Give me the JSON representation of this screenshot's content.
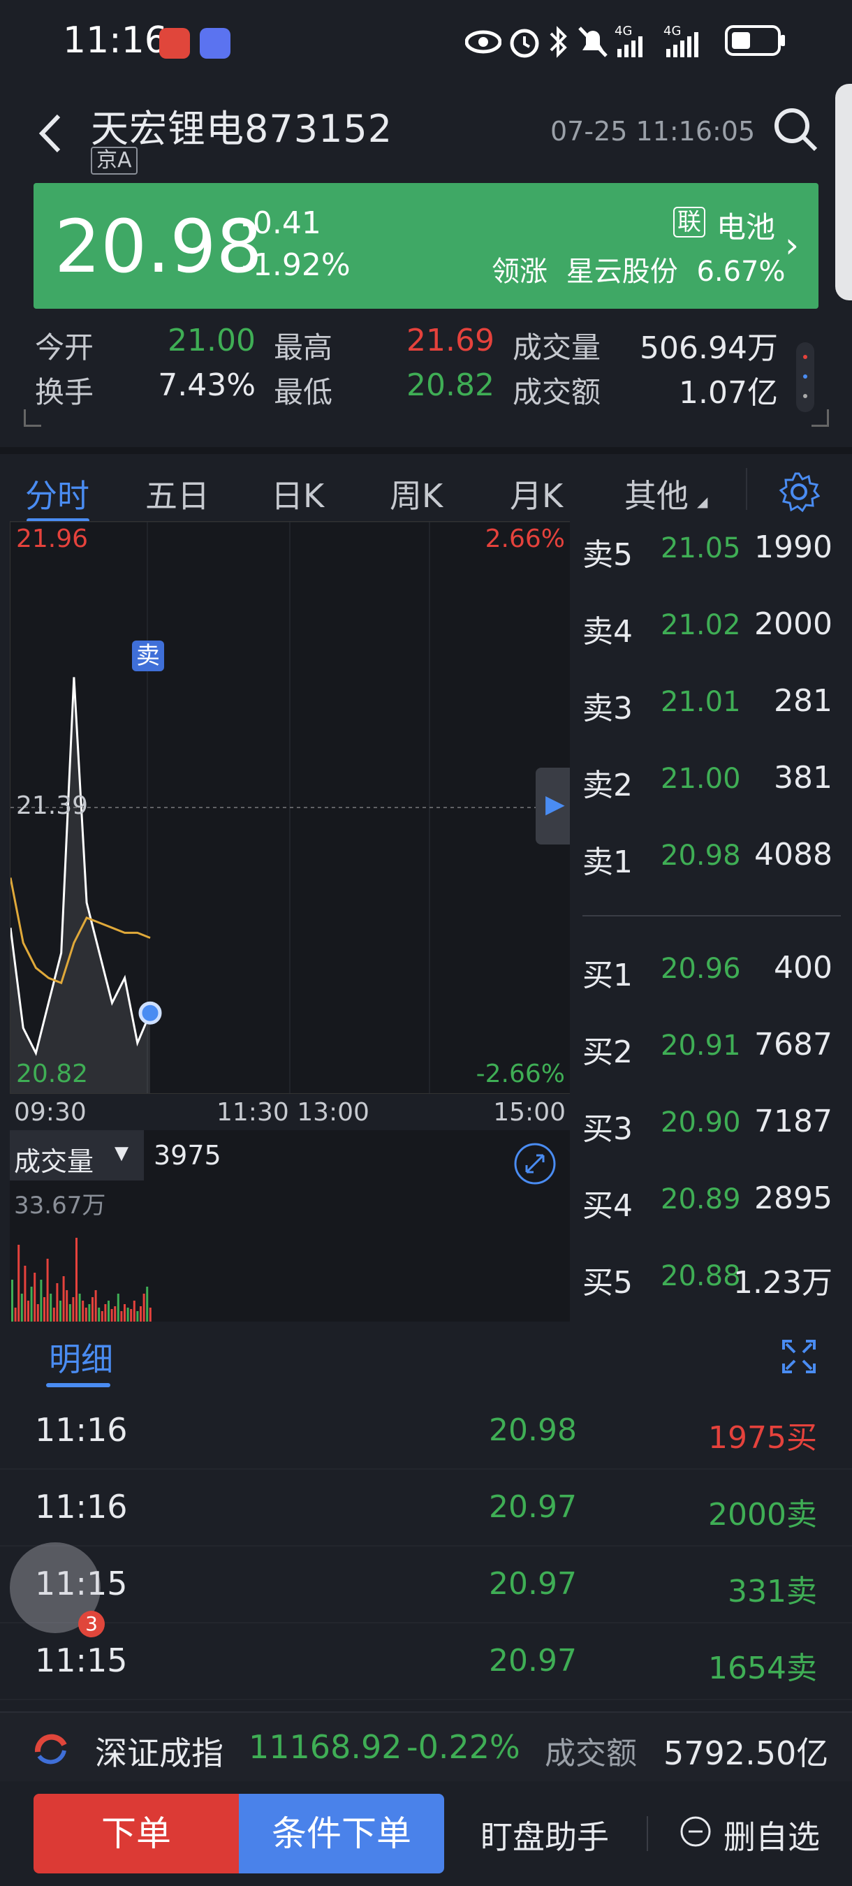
{
  "status_bar": {
    "time": "11:16",
    "icons": [
      "app-badge-red",
      "app-badge-music",
      "eye-icon",
      "alarm-icon",
      "bluetooth-icon",
      "mute-icon",
      "signal-4g-icon",
      "signal-4g-icon",
      "battery-icon"
    ]
  },
  "header": {
    "stock_name": "天宏锂电873152",
    "market_tag": "京A",
    "datetime": "07-25 11:16:05"
  },
  "price_banner": {
    "price": "20.98",
    "change": "-0.41",
    "change_pct": "-1.92%",
    "sector_tag": "联",
    "sector": "电池",
    "leader_label": "领涨",
    "leader_name": "星云股份",
    "leader_pct": "6.67%",
    "bg_color": "#3fa865"
  },
  "stats": {
    "row1": [
      {
        "label": "今开",
        "value": "21.00"
      },
      {
        "label": "最高",
        "value": "21.69"
      },
      {
        "label": "成交量",
        "value": "506.94万"
      }
    ],
    "row2": [
      {
        "label": "换手",
        "value": "7.43%"
      },
      {
        "label": "最低",
        "value": "20.82"
      },
      {
        "label": "成交额",
        "value": "1.07亿"
      }
    ]
  },
  "tabs": [
    "分时",
    "五日",
    "日K",
    "周K",
    "月K",
    "其他"
  ],
  "active_tab": "分时",
  "chart": {
    "top_left": "21.96",
    "top_right": "2.66%",
    "mid_left": "21.39",
    "bottom_left": "20.82",
    "bottom_right": "-2.66%",
    "x_labels": [
      "09:30",
      "11:30 13:00",
      "15:00"
    ],
    "sell_marker": "卖",
    "volume_label": "成交量",
    "volume_value": "3975",
    "volume_max": "33.67万"
  },
  "chart_data": {
    "type": "line",
    "x": [
      "09:30",
      "09:40",
      "09:50",
      "10:00",
      "10:10",
      "10:20",
      "10:30",
      "10:40",
      "10:50",
      "11:00",
      "11:10",
      "11:16"
    ],
    "series": [
      {
        "values": [
          21.15,
          20.95,
          20.9,
          21.0,
          21.1,
          21.65,
          21.2,
          21.1,
          21.0,
          21.05,
          20.92,
          20.98
        ]
      },
      {
        "values": [
          21.25,
          21.12,
          21.07,
          21.05,
          21.04,
          21.12,
          21.17,
          21.16,
          21.15,
          21.14,
          21.14,
          21.13
        ]
      }
    ],
    "ylim": [
      20.82,
      21.96
    ]
  },
  "order_book": {
    "sell": [
      {
        "label": "卖5",
        "price": "21.05",
        "vol": "1990"
      },
      {
        "label": "卖4",
        "price": "21.02",
        "vol": "2000"
      },
      {
        "label": "卖3",
        "price": "21.01",
        "vol": "281"
      },
      {
        "label": "卖2",
        "price": "21.00",
        "vol": "381"
      },
      {
        "label": "卖1",
        "price": "20.98",
        "vol": "4088"
      }
    ],
    "buy": [
      {
        "label": "买1",
        "price": "20.96",
        "vol": "400"
      },
      {
        "label": "买2",
        "price": "20.91",
        "vol": "7687"
      },
      {
        "label": "买3",
        "price": "20.90",
        "vol": "7187"
      },
      {
        "label": "买4",
        "price": "20.89",
        "vol": "2895"
      },
      {
        "label": "买5",
        "price": "20.88",
        "vol": "1.23万"
      }
    ]
  },
  "detail": {
    "title": "明细",
    "rows": [
      {
        "time": "11:16",
        "price": "20.98",
        "vol": "1975买",
        "side": "buy"
      },
      {
        "time": "11:16",
        "price": "20.97",
        "vol": "2000卖",
        "side": "sell"
      },
      {
        "time": "11:15",
        "price": "20.97",
        "vol": "331卖",
        "side": "sell"
      },
      {
        "time": "11:15",
        "price": "20.97",
        "vol": "1654卖",
        "side": "sell"
      }
    ],
    "float_badge": "3"
  },
  "index_bar": {
    "name": "深证成指",
    "value": "11168.92",
    "pct": "-0.22%",
    "amount_label": "成交额",
    "amount": "5792.50亿"
  },
  "bottom": {
    "order": "下单",
    "conditional": "条件下单",
    "assistant": "盯盘助手",
    "remove": "删自选"
  }
}
